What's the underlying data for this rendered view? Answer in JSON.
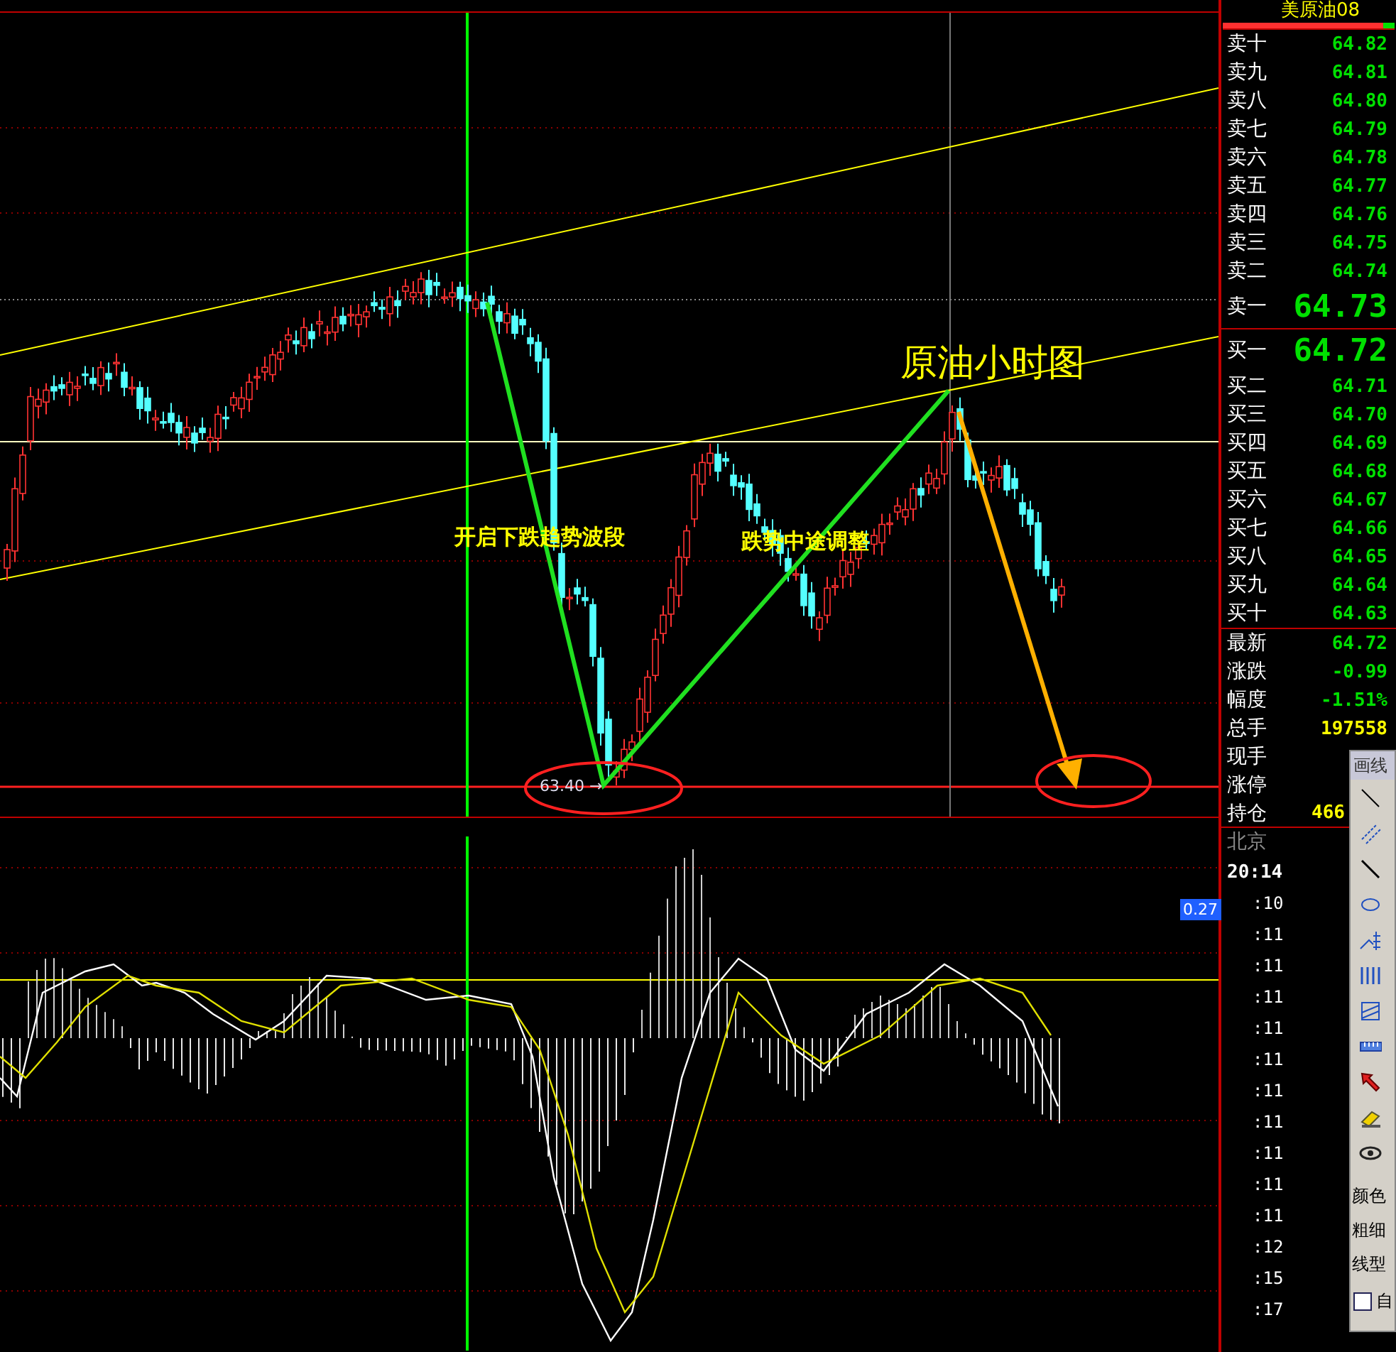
{
  "quote": {
    "title": "美原油08",
    "ratio_bar": {
      "level": 0.93
    }
  },
  "asks": [
    {
      "label": "卖十",
      "price": "64.82"
    },
    {
      "label": "卖九",
      "price": "64.81"
    },
    {
      "label": "卖八",
      "price": "64.80"
    },
    {
      "label": "卖七",
      "price": "64.79"
    },
    {
      "label": "卖六",
      "price": "64.78"
    },
    {
      "label": "卖五",
      "price": "64.77"
    },
    {
      "label": "卖四",
      "price": "64.76"
    },
    {
      "label": "卖三",
      "price": "64.75"
    },
    {
      "label": "卖二",
      "price": "64.74"
    },
    {
      "label": "卖一",
      "price": "64.73",
      "kind": "best"
    }
  ],
  "bids": [
    {
      "label": "买一",
      "price": "64.72",
      "kind": "best"
    },
    {
      "label": "买二",
      "price": "64.71"
    },
    {
      "label": "买三",
      "price": "64.70"
    },
    {
      "label": "买四",
      "price": "64.69"
    },
    {
      "label": "买五",
      "price": "64.68"
    },
    {
      "label": "买六",
      "price": "64.67"
    },
    {
      "label": "买七",
      "price": "64.66"
    },
    {
      "label": "买八",
      "price": "64.65"
    },
    {
      "label": "买九",
      "price": "64.64"
    },
    {
      "label": "买十",
      "price": "64.63"
    }
  ],
  "stats": [
    {
      "label": "最新",
      "value": "64.72",
      "color": "#00e000"
    },
    {
      "label": "涨跌",
      "value": "-0.99",
      "color": "#00e000"
    },
    {
      "label": "幅度",
      "value": "-1.51%",
      "color": "#00e000"
    },
    {
      "label": "总手",
      "value": "197558",
      "color": "#ffff00"
    },
    {
      "label": "现手"
    },
    {
      "label": "涨停"
    },
    {
      "label": "持仓",
      "value": "466",
      "color": "#ffff00"
    }
  ],
  "ticks": {
    "location": "北京",
    "time": "20:14",
    "rows": [
      ":10",
      ":11",
      ":11",
      ":11",
      ":11",
      ":11",
      ":11",
      ":11",
      ":11",
      ":11",
      ":11",
      ":12",
      ":15",
      ":17"
    ]
  },
  "chart": {
    "title": "原油小时图",
    "annotations": [
      "开启下跌趋势波段",
      "跌势中途调整"
    ],
    "low_label": "63.40 →"
  },
  "indicator": {
    "value_label": "0.27"
  },
  "drawing_toolbar": {
    "title": "画线",
    "options": [
      "颜色",
      "粗细",
      "线型"
    ],
    "checkbox": {
      "label": "自",
      "checked": false
    }
  }
}
